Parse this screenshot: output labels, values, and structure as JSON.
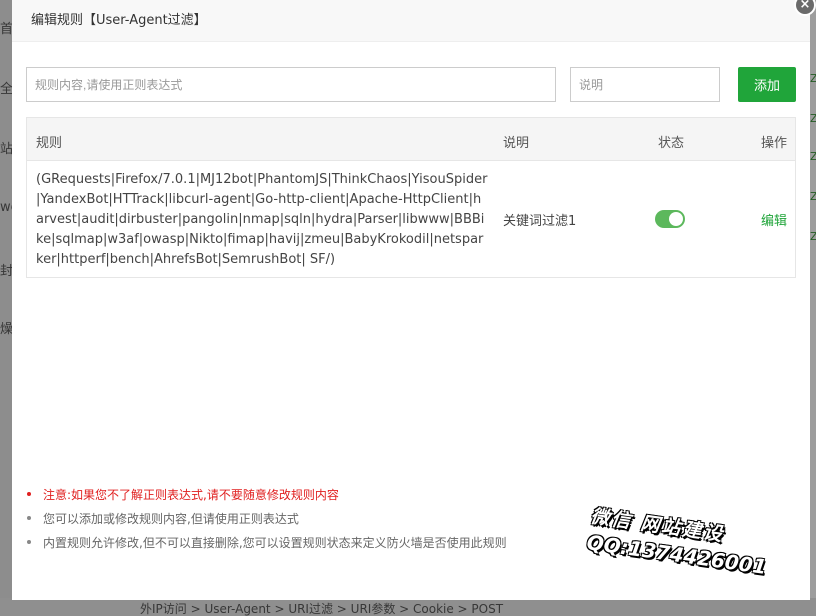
{
  "background": {
    "left_fragments": [
      "首",
      "全",
      "站",
      "we",
      "封",
      "燥"
    ],
    "right_fragments": [
      "Z",
      "Z",
      "Z",
      "Z",
      "Z"
    ],
    "bottom_crumb": "外IP访问 > User-Agent > URI过滤 > URI参数 > Cookie > POST"
  },
  "modal": {
    "title": "编辑规则【User-Agent过滤】",
    "close_icon": "×"
  },
  "form": {
    "rule_placeholder": "规则内容,请使用正则表达式",
    "rule_value": "",
    "desc_placeholder": "说明",
    "desc_value": "",
    "add_label": "添加"
  },
  "table": {
    "headers": {
      "rule": "规则",
      "desc": "说明",
      "status": "状态",
      "action": "操作"
    },
    "rows": [
      {
        "rule": "(GRequests|Firefox/7.0.1|MJ12bot|PhantomJS|ThinkChaos|YisouSpider|YandexBot|HTTrack|libcurl-agent|Go-http-client|Apache-HttpClient|harvest|audit|dirbuster|pangolin|nmap|sqln|hydra|Parser|libwww|BBBike|sqlmap|w3af|owasp|Nikto|fimap|havij|zmeu|BabyKrokodil|netsparker|httperf|bench|AhrefsBot|SemrushBot| SF/)",
        "desc": "关键词过滤1",
        "status_on": true,
        "action": "编辑"
      }
    ]
  },
  "notes": [
    "注意:如果您不了解正则表达式,请不要随意修改规则内容",
    "您可以添加或修改规则内容,但请使用正则表达式",
    "内置规则允许修改,但不可以直接删除,您可以设置规则状态来定义防火墙是否使用此规则"
  ],
  "watermark": {
    "line1": "微信  网站建设",
    "line2": "QQ:1374426001"
  },
  "colors": {
    "accent": "#20a53a",
    "toggle_on": "#5cb85c",
    "warning": "#e02020"
  }
}
